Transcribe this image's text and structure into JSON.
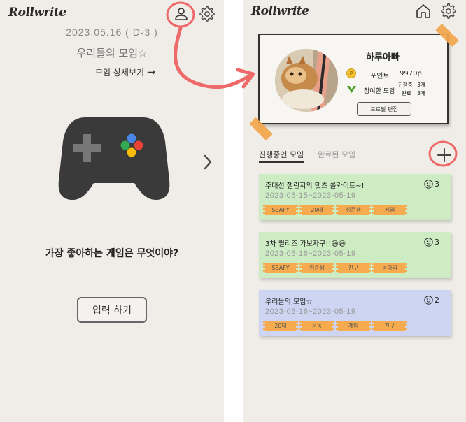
{
  "left_screen": {
    "logo": "Rollwrite",
    "date": "2023.05.16 ( D-3 )",
    "group_name": "우리들의 모임☆",
    "detail_link": "모임 상세보기",
    "detail_arrow": "→",
    "question": "가장 좋아하는 게임은 무엇이야?",
    "input_button": "입력 하기",
    "icons": [
      "profile-icon",
      "settings-icon",
      "game-controller-icon",
      "chevron-right-icon"
    ]
  },
  "right_screen": {
    "logo": "Rollwrite",
    "icons": [
      "home-icon",
      "settings-icon",
      "plus-icon"
    ],
    "profile": {
      "name": "하루아빠",
      "point_label": "포인트",
      "point_value": "9970p",
      "joined_label": "참여한 모임",
      "ongoing_label": "진행중",
      "ongoing_count": "3개",
      "done_label": "완료",
      "done_count": "3개",
      "edit_button": "프로필 편집"
    },
    "tabs": [
      {
        "label": "진행중인 모임",
        "active": true
      },
      {
        "label": "완료된 모임",
        "active": false
      }
    ],
    "meetings": [
      {
        "title": "주대선 챌린지의 댓츠 롤롸이트~!",
        "dates": "2023-05-15~2023-05-19",
        "count": "3",
        "color": "#cdecc4",
        "tags": [
          "SSAFY",
          "20대",
          "취준생",
          "게임"
        ]
      },
      {
        "title": "3차 릴리즈 가보자구!!😆😆",
        "dates": "2023-05-16~2023-05-19",
        "count": "3",
        "color": "#cdecc4",
        "tags": [
          "SSAFY",
          "취준생",
          "친구",
          "동아리"
        ]
      },
      {
        "title": "우리들의 모임☆",
        "dates": "2023-05-16~2023-05-19",
        "count": "2",
        "color": "#cdd5f3",
        "tags": [
          "20대",
          "운동",
          "게임",
          "친구"
        ]
      }
    ]
  },
  "colors": {
    "background": "#f0ede8",
    "annotation_red": "#ee6a6a",
    "tape_orange": "#f2a54a",
    "meeting_green": "#cdecc4",
    "meeting_blue": "#cdd5f3",
    "point_coin": "#f2c230",
    "check_green": "#4aa32a"
  }
}
